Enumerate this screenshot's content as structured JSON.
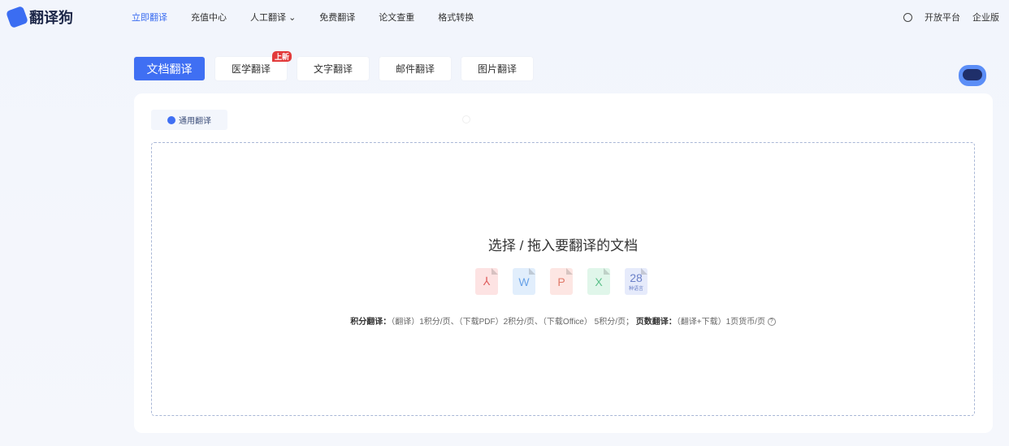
{
  "header": {
    "logo_text": "翻译狗",
    "nav": [
      "立即翻译",
      "充值中心",
      "人工翻译",
      "免费翻译",
      "论文查重",
      "格式转换"
    ],
    "right": [
      "开放平台",
      "企业版"
    ]
  },
  "tabs": [
    {
      "label": "文档翻译"
    },
    {
      "label": "医学翻译",
      "badge": "上新"
    },
    {
      "label": "文字翻译"
    },
    {
      "label": "邮件翻译"
    },
    {
      "label": "图片翻译"
    }
  ],
  "subtab": "通用翻译",
  "upload": {
    "title": "选择 / 拖入要翻译的文档",
    "file_icons": [
      {
        "name": "pdf",
        "glyph": "⅄",
        "color": "#fde3e3",
        "fg": "#e06060"
      },
      {
        "name": "word",
        "glyph": "W",
        "color": "#e1eefc",
        "fg": "#6aa3e8"
      },
      {
        "name": "ppt",
        "glyph": "P",
        "color": "#fde6e3",
        "fg": "#e07a6a"
      },
      {
        "name": "excel",
        "glyph": "X",
        "color": "#e0f6ea",
        "fg": "#5cc08a"
      },
      {
        "name": "languages",
        "glyph": "28",
        "sub": "种语言",
        "color": "#e6ebfb",
        "fg": "#6b80c8"
      }
    ],
    "info": {
      "label1": "积分翻译：",
      "text1": "（翻译）1积分/页、（下载PDF）2积分/页、（下载Office） 5积分/页；",
      "label2": "页数翻译：",
      "text2": "（翻译+下载）1页货币/页",
      "help": "?"
    }
  }
}
